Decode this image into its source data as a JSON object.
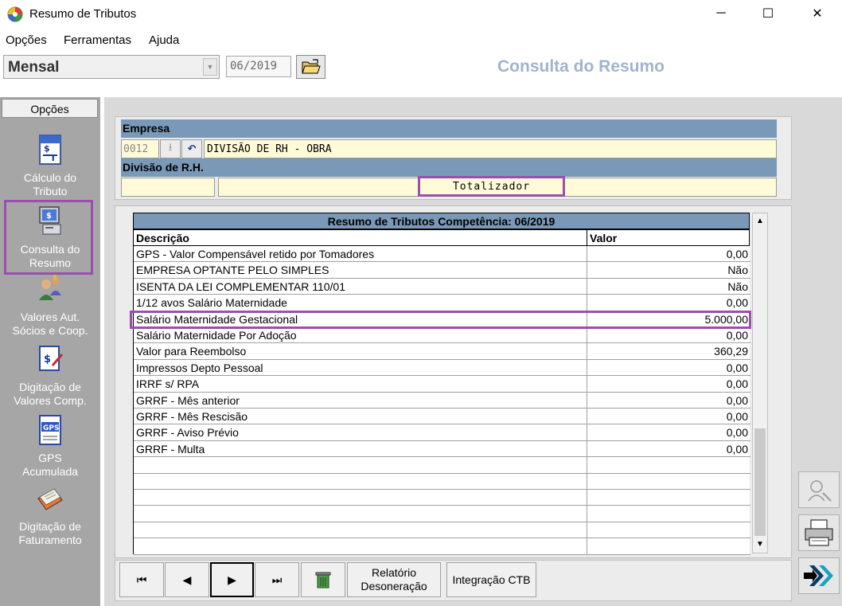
{
  "window": {
    "title": "Resumo de Tributos",
    "minimize_glyph": "─",
    "maximize_glyph": "☐",
    "close_glyph": "✕"
  },
  "menu": {
    "items": [
      "Opções",
      "Ferramentas",
      "Ajuda"
    ]
  },
  "toolbar": {
    "mode_value": "Mensal",
    "period_value": "06/2019",
    "page_title": "Consulta do Resumo"
  },
  "sidebar": {
    "header": "Opções",
    "items": [
      {
        "label": "Cálculo do Tributo",
        "icon": "tax-calc-icon"
      },
      {
        "label": "Consulta do Resumo",
        "icon": "computer-tax-icon"
      },
      {
        "label": "Valores Aut. Sócios e Coop.",
        "icon": "people-money-icon"
      },
      {
        "label": "Digitação de Valores Comp.",
        "icon": "edit-money-icon"
      },
      {
        "label": "GPS Acumulada",
        "icon": "gps-document-icon"
      },
      {
        "label": "Digitação de Faturamento",
        "icon": "ledger-book-icon"
      }
    ]
  },
  "empresa": {
    "label": "Empresa",
    "code": "0012",
    "name": "DIVISÃO DE RH - OBRA",
    "divisao_label": "Divisão de R.H.",
    "totalizador": "Totalizador"
  },
  "table": {
    "title": "Resumo de Tributos Competência: 06/2019",
    "col_descricao": "Descrição",
    "col_valor": "Valor",
    "rows": [
      {
        "descricao": "GPS - Valor Compensável retido por Tomadores",
        "valor": "0,00"
      },
      {
        "descricao": "EMPRESA OPTANTE PELO SIMPLES",
        "valor": "Não"
      },
      {
        "descricao": "ISENTA DA LEI COMPLEMENTAR 110/01",
        "valor": "Não"
      },
      {
        "descricao": "1/12 avos Salário Maternidade",
        "valor": "0,00"
      },
      {
        "descricao": "Salário Maternidade Gestacional",
        "valor": "5.000,00"
      },
      {
        "descricao": "Salário Maternidade Por Adoção",
        "valor": "0,00"
      },
      {
        "descricao": "Valor para Reembolso",
        "valor": "360,29"
      },
      {
        "descricao": "Impressos Depto Pessoal",
        "valor": "0,00"
      },
      {
        "descricao": "IRRF s/ RPA",
        "valor": "0,00"
      },
      {
        "descricao": "GRRF - Mês anterior",
        "valor": "0,00"
      },
      {
        "descricao": "GRRF - Mês Rescisão",
        "valor": "0,00"
      },
      {
        "descricao": "GRRF - Aviso Prévio",
        "valor": "0,00"
      },
      {
        "descricao": "GRRF - Multa",
        "valor": "0,00"
      },
      {
        "descricao": "",
        "valor": ""
      },
      {
        "descricao": "",
        "valor": ""
      },
      {
        "descricao": "",
        "valor": ""
      },
      {
        "descricao": "",
        "valor": ""
      },
      {
        "descricao": "",
        "valor": ""
      },
      {
        "descricao": "",
        "valor": ""
      }
    ]
  },
  "bottom": {
    "first_glyph": "⏮",
    "prev_glyph": "◀",
    "next_glyph": "▶",
    "last_glyph": "⏭",
    "relatorio_label": "Relatório Desoneração",
    "integracao_label": "Integração CTB"
  },
  "colors": {
    "accent_highlight": "#9a4fb0",
    "header_blue": "#7a98b7",
    "title_blue": "#9fb4cc",
    "field_yellow": "#fffbd9"
  }
}
